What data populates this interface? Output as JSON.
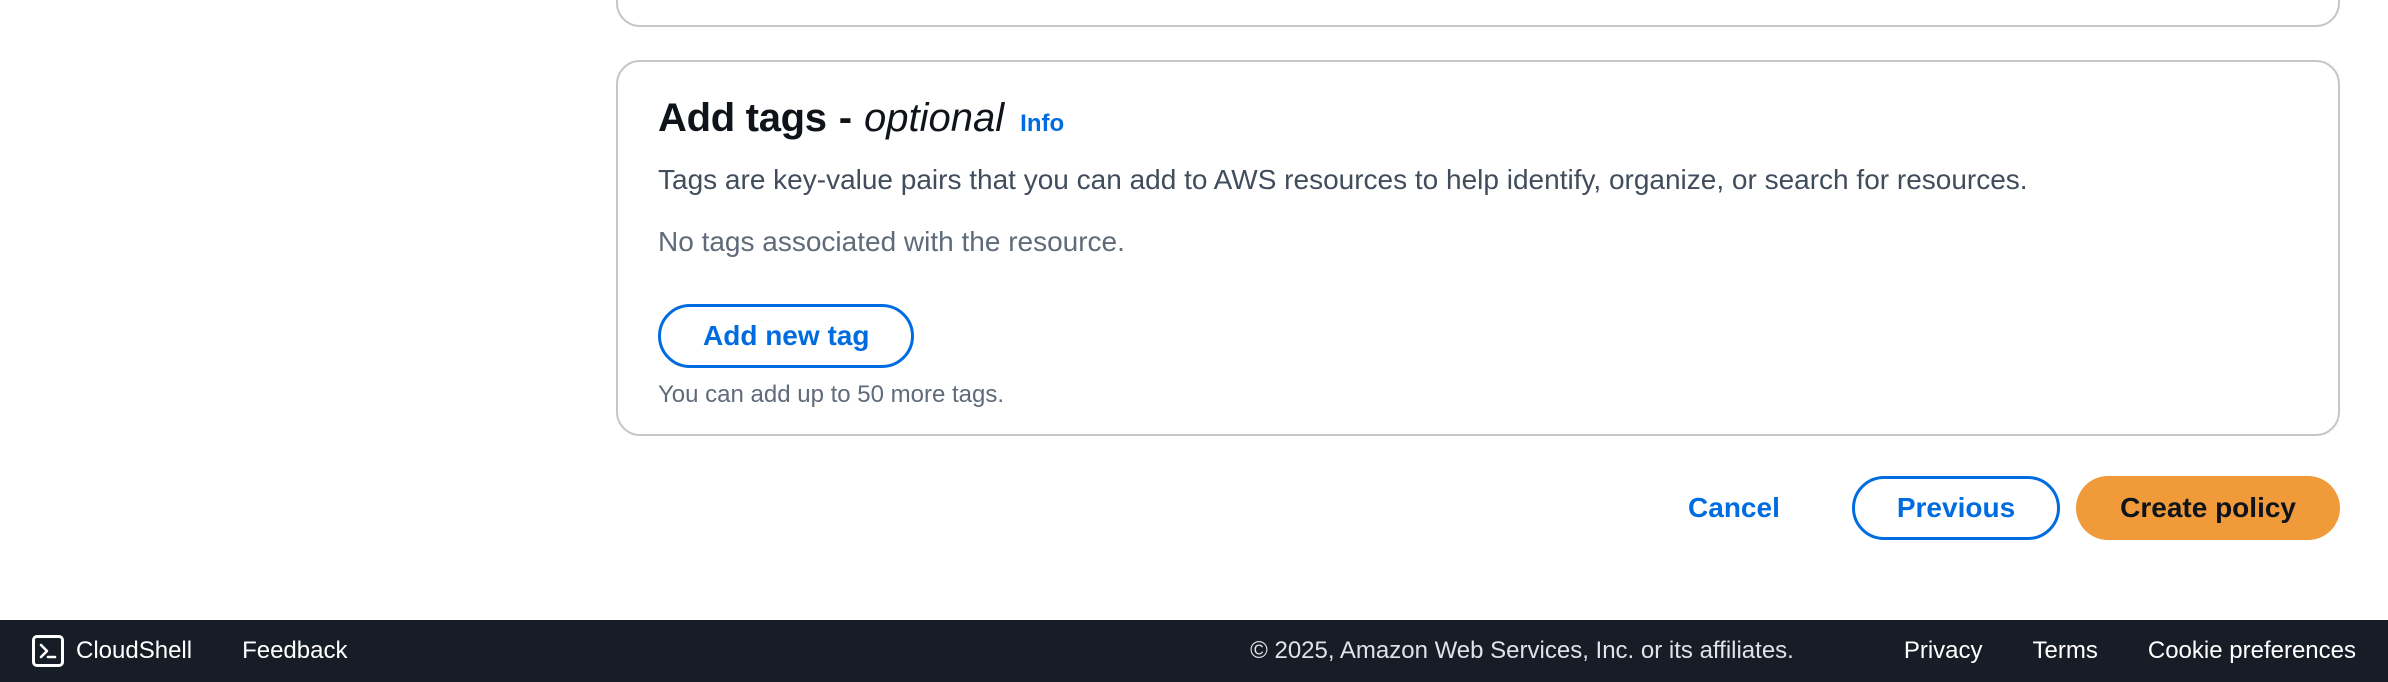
{
  "tags_section": {
    "title": "Add tags",
    "title_separator": "-",
    "title_optional": "optional",
    "info_label": "Info",
    "description": "Tags are key-value pairs that you can add to AWS resources to help identify, organize, or search for resources.",
    "empty_text": "No tags associated with the resource.",
    "add_button_label": "Add new tag",
    "hint": "You can add up to 50 more tags."
  },
  "actions": {
    "cancel_label": "Cancel",
    "previous_label": "Previous",
    "create_label": "Create policy"
  },
  "footer": {
    "cloudshell_label": "CloudShell",
    "cloudshell_icon": "terminal-icon",
    "feedback_label": "Feedback",
    "copyright": "© 2025, Amazon Web Services, Inc. or its affiliates.",
    "privacy_label": "Privacy",
    "terms_label": "Terms",
    "cookie_label": "Cookie preferences"
  },
  "colors": {
    "link": "#006ce0",
    "primary_button": "#f09a3a",
    "footer_bg": "#161d26",
    "border": "#c6c6cd"
  }
}
